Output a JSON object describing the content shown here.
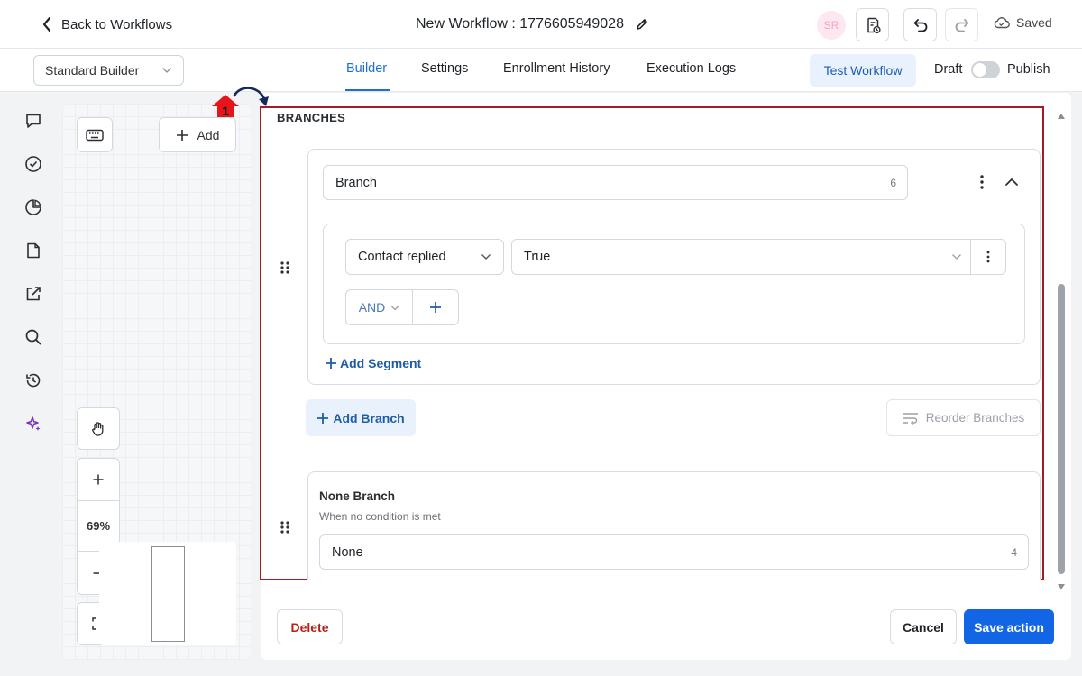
{
  "header": {
    "back_label": "Back to Workflows",
    "workflow_title": "New Workflow : 1776605949028",
    "avatar_initials": "SR",
    "saved_label": "Saved"
  },
  "subbar": {
    "builder_select_value": "Standard Builder",
    "tabs": [
      {
        "label": "Builder",
        "active": true
      },
      {
        "label": "Settings",
        "active": false
      },
      {
        "label": "Enrollment History",
        "active": false
      },
      {
        "label": "Execution Logs",
        "active": false
      }
    ],
    "test_workflow_label": "Test Workflow",
    "draft_label": "Draft",
    "publish_label": "Publish"
  },
  "left_rail": {
    "icons": [
      "chat-icon",
      "check-circle-icon",
      "pie-chart-icon",
      "document-icon",
      "external-link-icon",
      "search-icon",
      "history-icon",
      "sparkles-icon"
    ]
  },
  "canvas": {
    "add_label": "Add",
    "zoom_level": "69%"
  },
  "annotation": {
    "marker_number": "1"
  },
  "branches": {
    "heading": "BRANCHES",
    "branch": {
      "name": "Branch",
      "name_count": "6",
      "condition_field": "Contact replied",
      "condition_value": "True",
      "operator": "AND",
      "add_segment_label": "Add Segment"
    },
    "add_branch_label": "Add Branch",
    "reorder_label": "Reorder Branches",
    "none_branch": {
      "title": "None Branch",
      "subtitle": "When no condition is met",
      "name": "None",
      "name_count": "4"
    }
  },
  "footer": {
    "delete_label": "Delete",
    "cancel_label": "Cancel",
    "save_label": "Save action"
  },
  "colors": {
    "accent": "#1266e6",
    "tab_active": "#1e6fd0",
    "highlight_frame": "#a21c26",
    "delete_text": "#b42318",
    "marker_red": "#e8141c",
    "sparkles_purple": "#7a2fbf"
  }
}
